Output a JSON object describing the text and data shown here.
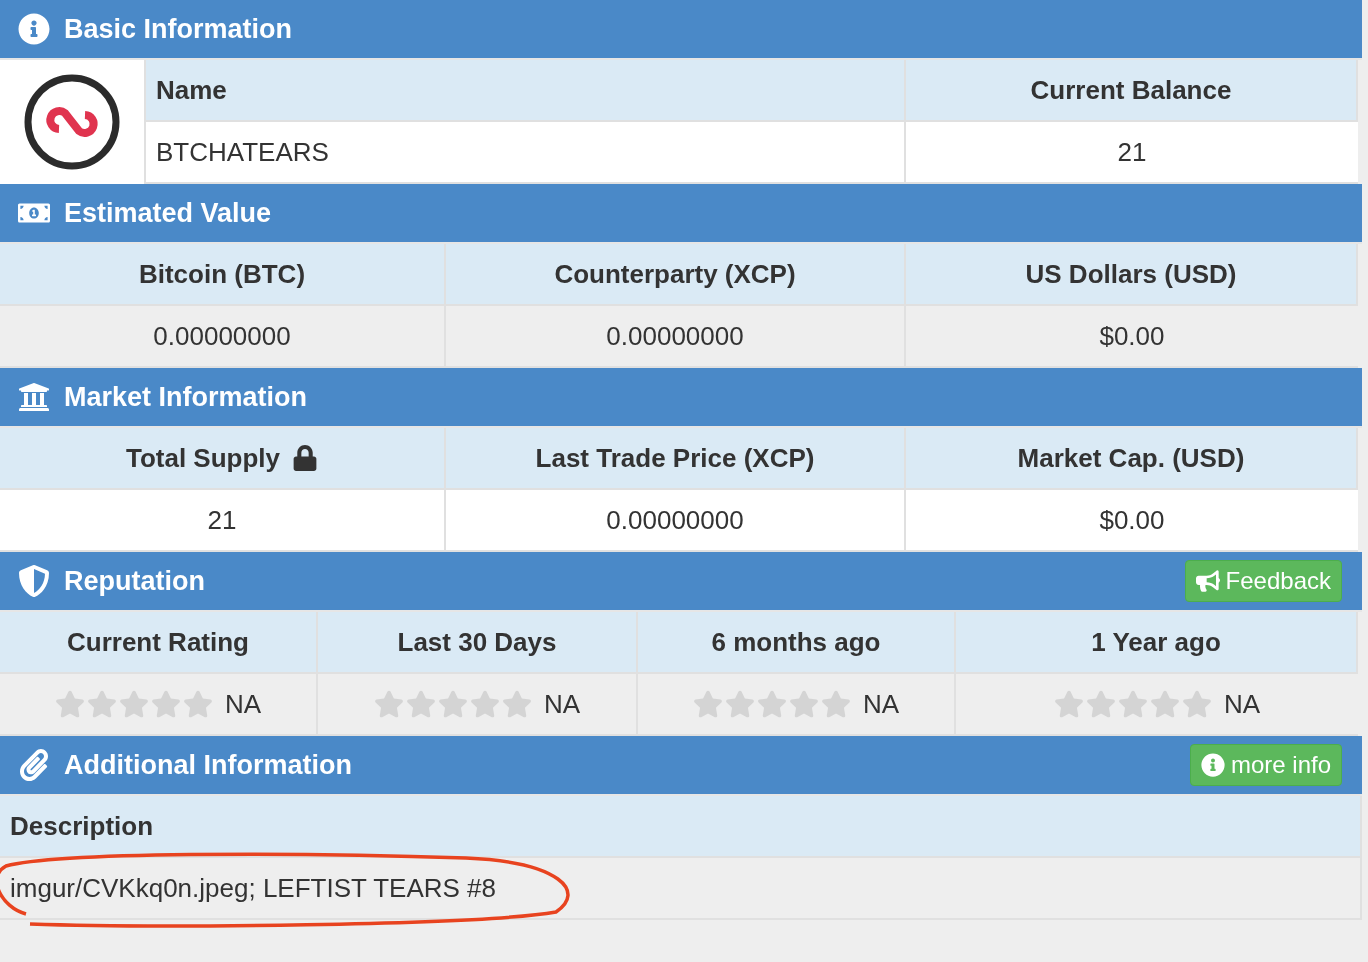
{
  "basic_information": {
    "title": "Basic Information",
    "columns": [
      "Name",
      "Current Balance"
    ],
    "values": [
      "BTCHATEARS",
      "21"
    ]
  },
  "estimated_value": {
    "title": "Estimated Value",
    "columns": [
      "Bitcoin (BTC)",
      "Counterparty (XCP)",
      "US Dollars (USD)"
    ],
    "values": [
      "0.00000000",
      "0.00000000",
      "$0.00"
    ]
  },
  "market_information": {
    "title": "Market Information",
    "columns": [
      {
        "label": "Total Supply",
        "locked": true
      },
      {
        "label": "Last Trade Price (XCP)",
        "locked": false
      },
      {
        "label": "Market Cap. (USD)",
        "locked": false
      }
    ],
    "values": [
      "21",
      "0.00000000",
      "$0.00"
    ]
  },
  "reputation": {
    "title": "Reputation",
    "button": "Feedback",
    "ratings": [
      {
        "label": "Current Rating",
        "stars": 0,
        "value": "NA"
      },
      {
        "label": "Last 30 Days",
        "stars": 0,
        "value": "NA"
      },
      {
        "label": "6 months ago",
        "stars": 0,
        "value": "NA"
      },
      {
        "label": "1 Year ago",
        "stars": 0,
        "value": "NA"
      }
    ]
  },
  "additional_information": {
    "title": "Additional Information",
    "button": "more info",
    "label": "Description",
    "description": "imgur/CVKkq0n.jpeg; LEFTIST TEARS #8"
  }
}
